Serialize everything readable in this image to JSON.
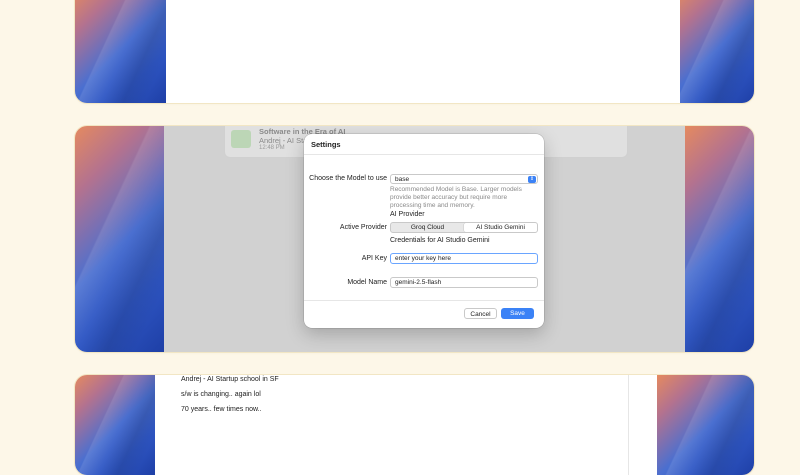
{
  "background_note": {
    "title": "Software in the Era of AI",
    "author": "Andrej - AI Sta",
    "time": "12:48 PM"
  },
  "dialog": {
    "title": "Settings",
    "model_label": "Choose the Model to use",
    "model_value": "base",
    "model_hint": "Recommended Model is Base. Larger models provide better accuracy but require more processing time and memory.",
    "provider_section": "AI Provider",
    "provider_label": "Active Provider",
    "providers": [
      "Groq Cloud",
      "AI Studio Gemini"
    ],
    "selected_provider": "AI Studio Gemini",
    "credentials_heading": "Credentials for AI Studio Gemini",
    "api_key_label": "API Key",
    "api_key_placeholder": "enter your key here",
    "model_name_label": "Model Name",
    "model_name_value": "gemini-2.5-flash",
    "cancel_label": "Cancel",
    "save_label": "Save"
  },
  "notes": {
    "lines": [
      "Andrej - AI Startup school in SF",
      "s/w is changing.. again lol",
      "70 years.. few times now.."
    ]
  },
  "colors": {
    "accent": "#3b82f6",
    "page_bg": "#fdf7e8"
  }
}
